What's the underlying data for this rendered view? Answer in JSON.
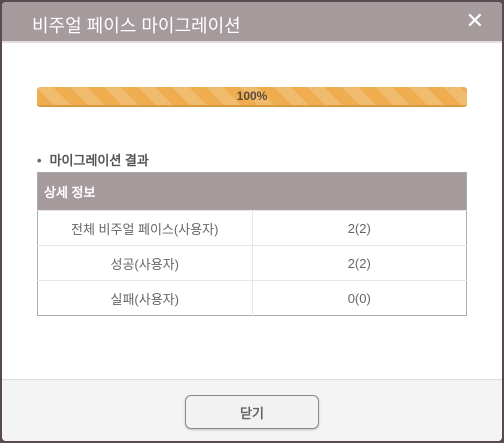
{
  "dialog": {
    "title": "비주얼 페이스 마이그레이션",
    "close_icon": "close-icon"
  },
  "progress": {
    "percent": 100,
    "label": "100%",
    "color": "#efad4f"
  },
  "section_title": "마이그레이션 결과",
  "table": {
    "header": "상세 정보",
    "rows": [
      {
        "label": "전체 비주얼 페이스(사용자)",
        "value": "2(2)"
      },
      {
        "label": "성공(사용자)",
        "value": "2(2)"
      },
      {
        "label": "실패(사용자)",
        "value": "0(0)"
      }
    ]
  },
  "footer": {
    "close_label": "닫기"
  }
}
